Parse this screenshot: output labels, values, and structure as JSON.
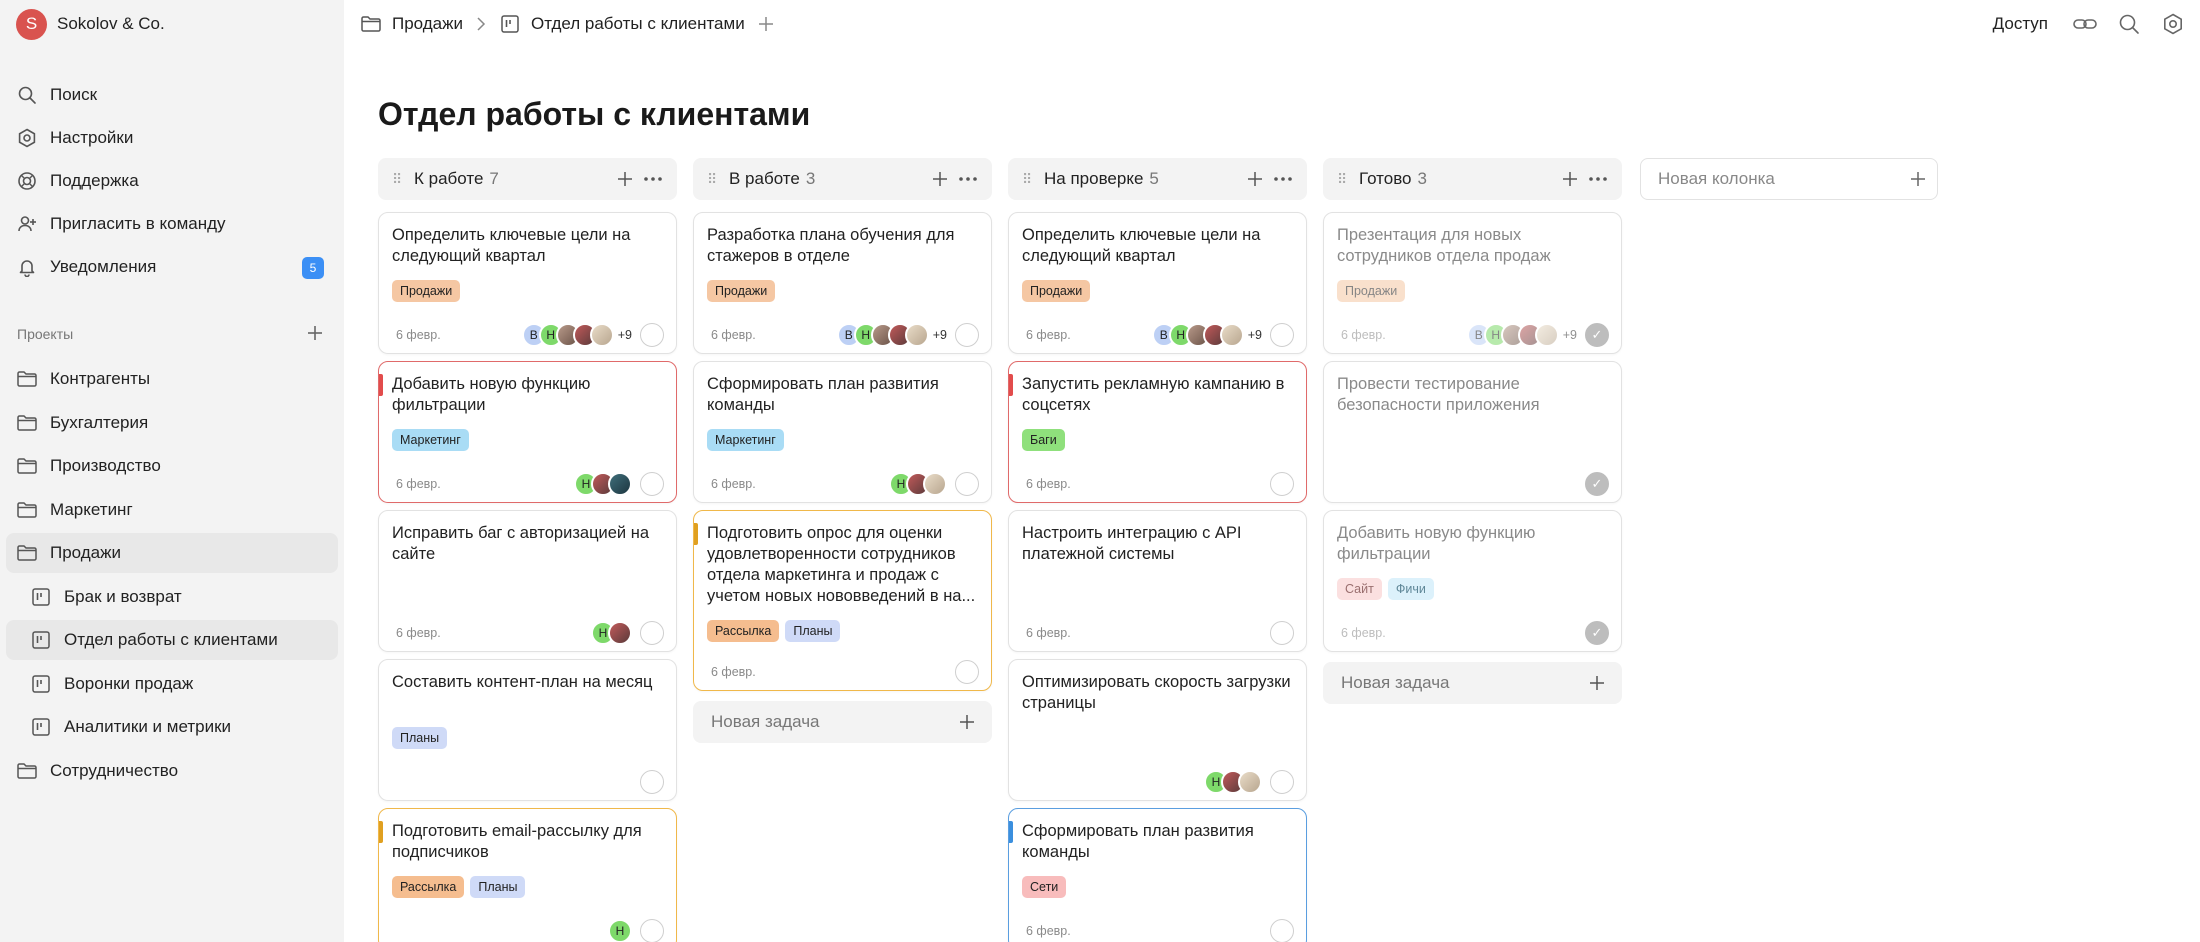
{
  "workspace": {
    "initial": "S",
    "name": "Sokolov & Co."
  },
  "nav": [
    {
      "label": "Поиск",
      "icon": "search-icon"
    },
    {
      "label": "Настройки",
      "icon": "gear-icon"
    },
    {
      "label": "Поддержка",
      "icon": "support-icon"
    },
    {
      "label": "Пригласить в команду",
      "icon": "add-user-icon"
    },
    {
      "label": "Уведомления",
      "icon": "bell-icon",
      "badge": "5"
    }
  ],
  "projects_label": "Проекты",
  "projects": [
    {
      "label": "Контрагенты",
      "type": "folder"
    },
    {
      "label": "Бухгалтерия",
      "type": "folder"
    },
    {
      "label": "Производство",
      "type": "folder"
    },
    {
      "label": "Маркетинг",
      "type": "folder"
    },
    {
      "label": "Продажи",
      "type": "folder"
    },
    {
      "label": "Брак и возврат",
      "type": "board"
    },
    {
      "label": "Отдел работы с клиентами",
      "type": "board"
    },
    {
      "label": "Воронки продаж",
      "type": "board"
    },
    {
      "label": "Аналитики и метрики",
      "type": "board"
    },
    {
      "label": "Сотрудничество",
      "type": "folder"
    }
  ],
  "breadcrumb": {
    "folder": "Продажи",
    "board": "Отдел работы с клиентами"
  },
  "topbar": {
    "access": "Доступ"
  },
  "page_title": "Отдел работы с клиентами",
  "new_column_placeholder": "Новая колонка",
  "new_task_label": "Новая задача",
  "columns": [
    {
      "title": "К работе",
      "count": "7",
      "cards": [
        {
          "title": "Определить ключевые цели на следующий квартал",
          "tags": [
            "Продажи"
          ],
          "date": "6 февр.",
          "avatars": [
            "В",
            "Н",
            "p1",
            "p2",
            "p3"
          ],
          "more": "+9"
        },
        {
          "title": "Добавить новую функцию фильтрации",
          "tags": [
            "Маркетинг"
          ],
          "date": "6 февр.",
          "avatars": [
            "Н",
            "p2",
            "p4"
          ],
          "accent": "red"
        },
        {
          "title": "Исправить баг с авторизацией на сайте",
          "tags": [],
          "date": "6 февр.",
          "avatars": [
            "Н",
            "p2"
          ]
        },
        {
          "title": "Составить контент-план на месяц",
          "tags": [
            "Планы"
          ],
          "date": "",
          "avatars": []
        },
        {
          "title": "Подготовить email-рассылку для подписчиков",
          "tags": [
            "Рассылка",
            "Планы"
          ],
          "date": "",
          "avatars": [
            "Н"
          ],
          "accent": "orange"
        }
      ]
    },
    {
      "title": "В работе",
      "count": "3",
      "cards": [
        {
          "title": "Разработка плана обучения для стажеров в отделе",
          "tags": [
            "Продажи"
          ],
          "date": "6 февр.",
          "avatars": [
            "В",
            "Н",
            "p1",
            "p2",
            "p3"
          ],
          "more": "+9"
        },
        {
          "title": "Сформировать план развития команды",
          "tags": [
            "Маркетинг"
          ],
          "date": "6 февр.",
          "avatars": [
            "Н",
            "p2",
            "p3"
          ]
        },
        {
          "title": "Подготовить опрос для оценки удовлетворенности сотрудников отдела маркетинга и продаж с учетом новых нововведений в на...",
          "tags": [
            "Рассылка",
            "Планы"
          ],
          "date": "6 февр.",
          "avatars": [],
          "accent": "orange"
        }
      ]
    },
    {
      "title": "На проверке",
      "count": "5",
      "cards": [
        {
          "title": "Определить ключевые цели на следующий квартал",
          "tags": [
            "Продажи"
          ],
          "date": "6 февр.",
          "avatars": [
            "В",
            "Н",
            "p1",
            "p2",
            "p3"
          ],
          "more": "+9"
        },
        {
          "title": "Запустить рекламную кампанию в соцсетях",
          "tags": [
            "Баги"
          ],
          "date": "6 февр.",
          "avatars": [],
          "accent": "red"
        },
        {
          "title": "Настроить интеграцию с API платежной системы",
          "tags": [],
          "date": "6 февр.",
          "avatars": []
        },
        {
          "title": "Оптимизировать скорость загрузки страницы",
          "tags": [],
          "date": "",
          "avatars": [
            "Н",
            "p2",
            "p3"
          ]
        },
        {
          "title": "Сформировать план развития команды",
          "tags": [
            "Сети"
          ],
          "date": "6 февр.",
          "avatars": [],
          "accent": "blue"
        }
      ]
    },
    {
      "title": "Готово",
      "count": "3",
      "cards": [
        {
          "title": "Презентация для новых сотрудников отдела продаж",
          "tags": [
            "Продажи"
          ],
          "date": "6 февр.",
          "avatars": [
            "В",
            "Н",
            "p1",
            "p2",
            "p3"
          ],
          "more": "+9",
          "done": true
        },
        {
          "title": "Провести тестирование безопасности приложения",
          "tags": [],
          "date": "",
          "avatars": [],
          "done": true
        },
        {
          "title": "Добавить новую функцию фильтрации",
          "tags": [
            "Сайт",
            "Фичи"
          ],
          "date": "6 февр.",
          "avatars": [],
          "done": true
        }
      ]
    }
  ],
  "colors": {
    "accent_red": "#e24c4c",
    "accent_orange": "#e0a020",
    "accent_blue": "#3b8fde",
    "badge_blue": "#3b8ff5",
    "sidebar_bg": "#f3f3f3"
  }
}
